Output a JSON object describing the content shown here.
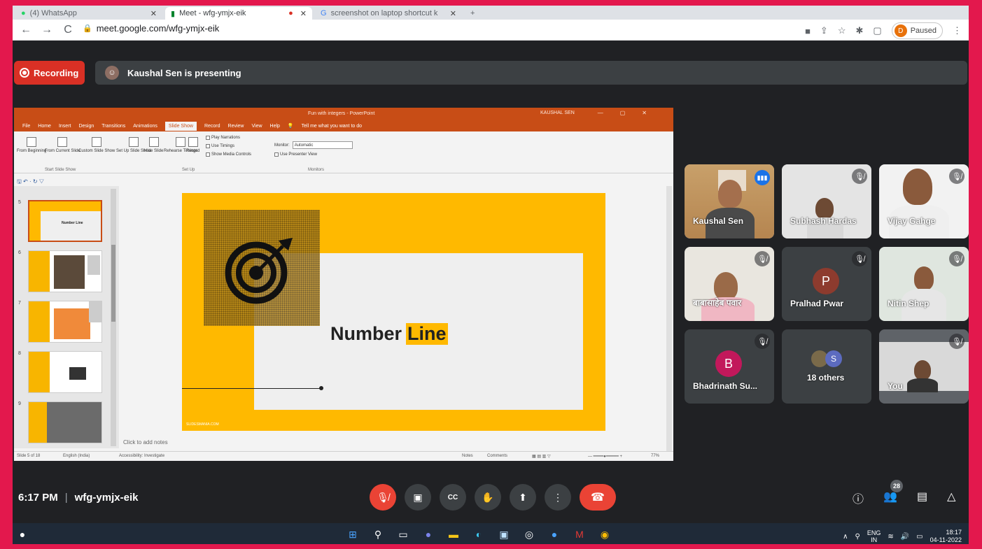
{
  "browser": {
    "tabs": [
      {
        "label": "(4) WhatsApp"
      },
      {
        "label": "Meet - wfg-ymjx-eik"
      },
      {
        "label": "screenshot on laptop shortcut k"
      }
    ],
    "url": "meet.google.com/wfg-ymjx-eik",
    "profile_initial": "D",
    "profile_status": "Paused"
  },
  "meet": {
    "recording_label": "Recording",
    "presenting_text": "Kaushal Sen is presenting",
    "meeting_code": "wfg-ymjx-eik",
    "time": "6:17 PM",
    "separator": "|",
    "participant_count": "28"
  },
  "powerpoint": {
    "title": "Fun with integers - PowerPoint",
    "user_name": "KAUSHAL SEN",
    "menu": [
      "File",
      "Home",
      "Insert",
      "Design",
      "Transitions",
      "Animations",
      "Slide Show",
      "Record",
      "Review",
      "View",
      "Help"
    ],
    "selected_menu": "Slide Show",
    "tell_me": "Tell me what you want to do",
    "ribbon": {
      "from_beginning": "From Beginning",
      "from_current": "From Current Slide",
      "custom_show": "Custom Slide Show",
      "group_start": "Start Slide Show",
      "set_up": "Set Up Slide Show",
      "hide_slide": "Hide Slide",
      "rehearse": "Rehearse Timings",
      "record": "Record",
      "play_narrations": "Play Narrations",
      "use_timings": "Use Timings",
      "show_media": "Show Media Controls",
      "group_setup": "Set Up",
      "monitor_label": "Monitor:",
      "monitor_value": "Automatic",
      "presenter_view": "Use Presenter View",
      "group_monitors": "Monitors"
    },
    "slide_numbers": [
      "5",
      "6",
      "7",
      "8",
      "9"
    ],
    "thumb_title": "Number Line",
    "slide_title_part1": "Number",
    "slide_title_part2": "Line",
    "slide_footer": "SLIDESMANIA.COM",
    "notes_placeholder": "Click to add notes",
    "status": {
      "slide_of": "Slide 5 of 18",
      "language": "English (India)",
      "accessibility": "Accessibility: Investigate",
      "notes": "Notes",
      "comments": "Comments",
      "zoom": "77%"
    }
  },
  "participants": [
    {
      "name": "Kaushal Sen"
    },
    {
      "name": "Subhash Hardas"
    },
    {
      "name": "Vijay Gahge"
    },
    {
      "name": "बाबासाहेब पवार"
    },
    {
      "name": "Pralhad Pwar",
      "initial": "P"
    },
    {
      "name": "Nitin Shep"
    },
    {
      "name": "Bhadrinath Su...",
      "initial": "B"
    },
    {
      "name": "18 others",
      "initial": "S"
    },
    {
      "name": "You"
    }
  ],
  "taskbar": {
    "lang": "ENG",
    "region": "IN",
    "clock_time": "18:17",
    "clock_date": "04-11-2022"
  },
  "colors": {
    "frame_border": "#e3184d",
    "meet_bg": "#202124",
    "tile_bg": "#3c4043",
    "recording_red": "#d93025",
    "end_call_red": "#ea4335",
    "ppt_orange": "#c84d16",
    "slide_yellow": "#ffb900"
  }
}
